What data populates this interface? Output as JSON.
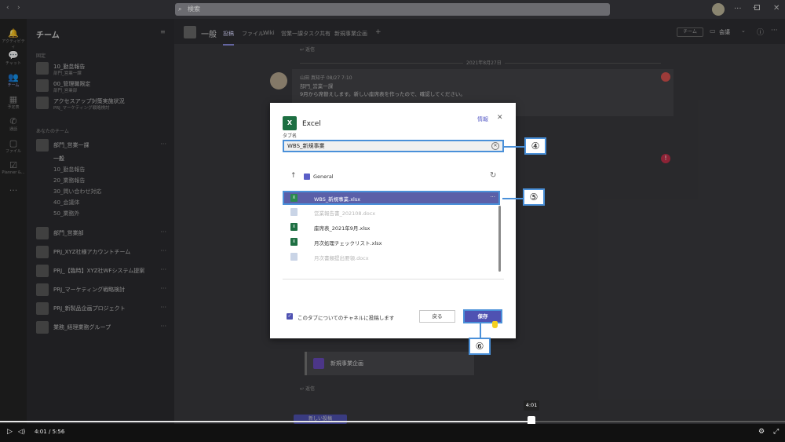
{
  "titlebar": {
    "search_placeholder": "検索"
  },
  "rail": {
    "items": [
      "アクティビティ",
      "チャット",
      "チーム",
      "予定表",
      "通話",
      "ファイル",
      "Planner &..."
    ]
  },
  "teams_panel": {
    "title": "チーム",
    "pinned_label": "固定",
    "pinned": [
      {
        "name": "10_勤怠報告",
        "sub": "部門_営業一課"
      },
      {
        "name": "00_管理職限定",
        "sub": "部門_営業部"
      },
      {
        "name": "アクセスアップ対策実施状況",
        "sub": "PRJ_マーケティング戦略検討"
      }
    ],
    "your_teams_label": "あなたのチーム",
    "teams": [
      {
        "name": "部門_営業一課",
        "channels": [
          "一般",
          "10_勤怠報告",
          "20_業務報告",
          "30_問い合わせ対応",
          "40_会議体",
          "50_業務外"
        ]
      },
      {
        "name": "部門_営業部"
      },
      {
        "name": "PRJ_XYZ社様アカウントチーム"
      },
      {
        "name": "PRJ_【臨時】XYZ社WFシステム提案"
      },
      {
        "name": "PRJ_マーケティング戦略検討"
      },
      {
        "name": "PRJ_新製品企画プロジェクト"
      },
      {
        "name": "業務_経理業務グループ"
      }
    ]
  },
  "channel_header": {
    "name": "一般",
    "tabs": [
      "投稿",
      "ファイル",
      "Wiki",
      "営業一課タスク共有",
      "新規事業企画"
    ],
    "team_button": "チーム",
    "meet_button": "会議"
  },
  "feed": {
    "reply": "返信",
    "date": "2021年8月27日",
    "author": "山田 真知子",
    "time": "08/27 7:10",
    "channel": "部門_営業一課",
    "message": "9月から席替えします。新しい座席表を作ったので、確認してください。",
    "card": "新規事業企画",
    "reply2": "返信",
    "new_post": "新しい投稿"
  },
  "dialog": {
    "app_name": "Excel",
    "info_link": "情報",
    "tab_name_label": "タブ名",
    "tab_name_value": "WBS_新規事業",
    "folder": "General",
    "files": [
      {
        "name": "WBS_新規事業.xlsx",
        "type": "xlsx",
        "state": "selected"
      },
      {
        "name": "営業報告書_202108.docx",
        "type": "docx",
        "state": "disabled"
      },
      {
        "name": "座席表_2021年9月.xlsx",
        "type": "xlsx",
        "state": "normal"
      },
      {
        "name": "月次処理チェックリスト.xlsx",
        "type": "xlsx",
        "state": "normal"
      },
      {
        "name": "月次書類提出要領.docx",
        "type": "docx",
        "state": "disabled"
      }
    ],
    "post_checkbox_label": "このタブについてのチャネルに投稿します",
    "post_checked": true,
    "back_button": "戻る",
    "save_button": "保存"
  },
  "callouts": {
    "c4": "④",
    "c5": "⑤",
    "c6": "⑥"
  },
  "video": {
    "current_time": "4:01",
    "separator": "/",
    "total_time": "5:56",
    "progress": 0.677,
    "tooltip": "4:01"
  },
  "colors": {
    "accent": "#5b5fc7",
    "callout_border": "#4a90d9",
    "excel_green": "#1d6f42"
  }
}
